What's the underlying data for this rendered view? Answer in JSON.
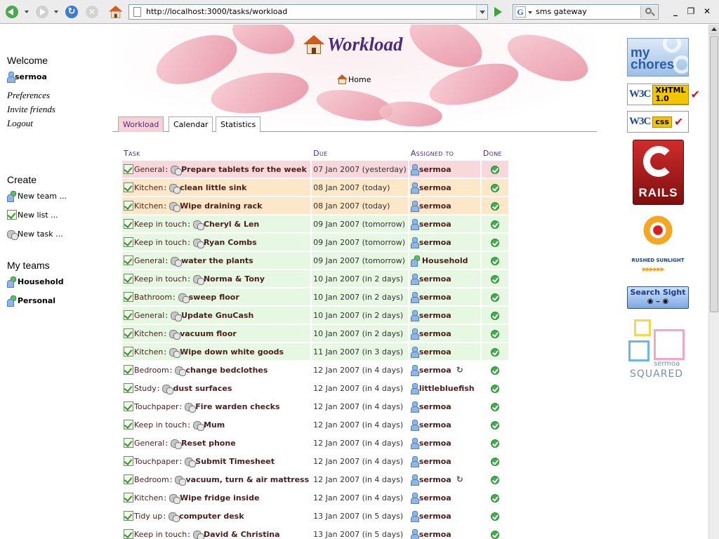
{
  "browser": {
    "url": "http://localhost:3000/tasks/workload",
    "search_engine_letter": "G",
    "search_value": "sms gateway",
    "window_buttons": {
      "minimize": "_",
      "restore": "❐",
      "close": "✕"
    },
    "reload_glyph": "↻",
    "stop_glyph": "✕"
  },
  "sidebar": {
    "welcome_heading": "Welcome",
    "username": "sermoa",
    "links": [
      "Preferences",
      "Invite friends",
      "Logout"
    ],
    "create_heading": "Create",
    "create_items": [
      "New team ...",
      "New list ...",
      "New task ..."
    ],
    "teams_heading": "My teams",
    "teams": [
      "Household",
      "Personal"
    ]
  },
  "header": {
    "title": "Workload",
    "home_link": "Home"
  },
  "tabs": [
    {
      "label": "Workload",
      "active": true
    },
    {
      "label": "Calendar",
      "active": false
    },
    {
      "label": "Statistics",
      "active": false
    }
  ],
  "table": {
    "headers": {
      "task": "Task",
      "due": "Due",
      "assigned": "Assigned to",
      "done": "Done"
    },
    "rows": [
      {
        "list": "General",
        "task": "Prepare tablets for the week",
        "due": "07 Jan 2007 (yesterday)",
        "assignee": "sermoa",
        "assignee_type": "person",
        "status": "overdue",
        "recurring": false
      },
      {
        "list": "Kitchen",
        "task": "clean little sink",
        "due": "08 Jan 2007 (today)",
        "assignee": "sermoa",
        "assignee_type": "person",
        "status": "today",
        "recurring": false
      },
      {
        "list": "Kitchen",
        "task": "Wipe draining rack",
        "due": "08 Jan 2007 (today)",
        "assignee": "sermoa",
        "assignee_type": "person",
        "status": "today",
        "recurring": false
      },
      {
        "list": "Keep in touch",
        "task": "Cheryl & Len",
        "due": "09 Jan 2007 (tomorrow)",
        "assignee": "sermoa",
        "assignee_type": "person",
        "status": "soon",
        "recurring": false
      },
      {
        "list": "Keep in touch",
        "task": "Ryan Combs",
        "due": "09 Jan 2007 (tomorrow)",
        "assignee": "sermoa",
        "assignee_type": "person",
        "status": "soon",
        "recurring": false
      },
      {
        "list": "General",
        "task": "water the plants",
        "due": "09 Jan 2007 (tomorrow)",
        "assignee": "Household",
        "assignee_type": "team",
        "status": "soon",
        "recurring": false
      },
      {
        "list": "Keep in touch",
        "task": "Norma & Tony",
        "due": "10 Jan 2007 (in 2 days)",
        "assignee": "sermoa",
        "assignee_type": "person",
        "status": "soon",
        "recurring": false
      },
      {
        "list": "Bathroom",
        "task": "sweep floor",
        "due": "10 Jan 2007 (in 2 days)",
        "assignee": "sermoa",
        "assignee_type": "person",
        "status": "soon",
        "recurring": false
      },
      {
        "list": "General",
        "task": "Update GnuCash",
        "due": "10 Jan 2007 (in 2 days)",
        "assignee": "sermoa",
        "assignee_type": "person",
        "status": "soon",
        "recurring": false
      },
      {
        "list": "Kitchen",
        "task": "vacuum floor",
        "due": "10 Jan 2007 (in 2 days)",
        "assignee": "sermoa",
        "assignee_type": "person",
        "status": "soon",
        "recurring": false
      },
      {
        "list": "Kitchen",
        "task": "Wipe down white goods",
        "due": "11 Jan 2007 (in 3 days)",
        "assignee": "sermoa",
        "assignee_type": "person",
        "status": "soon",
        "recurring": false
      },
      {
        "list": "Bedroom",
        "task": "change bedclothes",
        "due": "12 Jan 2007 (in 4 days)",
        "assignee": "sermoa",
        "assignee_type": "person",
        "status": "later",
        "recurring": true
      },
      {
        "list": "Study",
        "task": "dust surfaces",
        "due": "12 Jan 2007 (in 4 days)",
        "assignee": "littlebluefish",
        "assignee_type": "person",
        "status": "later",
        "recurring": false
      },
      {
        "list": "Touchpaper",
        "task": "Fire warden checks",
        "due": "12 Jan 2007 (in 4 days)",
        "assignee": "sermoa",
        "assignee_type": "person",
        "status": "later",
        "recurring": false
      },
      {
        "list": "Keep in touch",
        "task": "Mum",
        "due": "12 Jan 2007 (in 4 days)",
        "assignee": "sermoa",
        "assignee_type": "person",
        "status": "later",
        "recurring": false
      },
      {
        "list": "General",
        "task": "Reset phone",
        "due": "12 Jan 2007 (in 4 days)",
        "assignee": "sermoa",
        "assignee_type": "person",
        "status": "later",
        "recurring": false
      },
      {
        "list": "Touchpaper",
        "task": "Submit Timesheet",
        "due": "12 Jan 2007 (in 4 days)",
        "assignee": "sermoa",
        "assignee_type": "person",
        "status": "later",
        "recurring": false
      },
      {
        "list": "Bedroom",
        "task": "vacuum, turn & air mattress",
        "due": "12 Jan 2007 (in 4 days)",
        "assignee": "sermoa",
        "assignee_type": "person",
        "status": "later",
        "recurring": true
      },
      {
        "list": "Kitchen",
        "task": "Wipe fridge inside",
        "due": "12 Jan 2007 (in 4 days)",
        "assignee": "sermoa",
        "assignee_type": "person",
        "status": "later",
        "recurring": false
      },
      {
        "list": "Tidy up",
        "task": "computer desk",
        "due": "13 Jan 2007 (in 5 days)",
        "assignee": "sermoa",
        "assignee_type": "person",
        "status": "later",
        "recurring": false
      },
      {
        "list": "Keep in touch",
        "task": "David & Christina",
        "due": "13 Jan 2007 (in 5 days)",
        "assignee": "sermoa",
        "assignee_type": "person",
        "status": "later",
        "recurring": false
      }
    ],
    "recurring_glyph": "↻"
  },
  "badges": {
    "mychores": "my chores",
    "w3c_mark": "W3C",
    "xhtml_label": "XHTML 1.0",
    "css_label": "css",
    "check_glyph": "✔",
    "rails": "RAILS",
    "rushed_sunlight": "RUSHED SUNLIGHT",
    "sunlight_arrows": "▶▶▶▶▶▶",
    "search_sight": "Search Sight",
    "search_sight_eyes": "◉ ⌣ ◉",
    "sermoa_squared_top": "sermoa",
    "sermoa_squared_bottom": "SQUARED"
  },
  "colors": {
    "title_purple": "#4b2c7a",
    "overdue_row": "#f8d8dc",
    "today_row": "#fde7c9",
    "soon_row": "#e6f7e2",
    "done_green": "#3db04a"
  }
}
